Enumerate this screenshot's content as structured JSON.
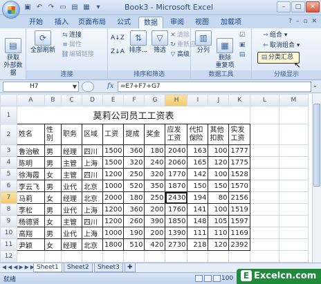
{
  "window": {
    "title": "Book3 - Microsoft Excel"
  },
  "tabs": [
    "开始",
    "插入",
    "页面布局",
    "公式",
    "数据",
    "审阅",
    "视图",
    "加载项"
  ],
  "active_tab": "数据",
  "ribbon": {
    "get_external": "获取\n外部数据",
    "refresh_all": "全部刷新",
    "connections": "连接",
    "properties": "属性",
    "edit_links": "编辑链接",
    "sort_az": "A↓Z",
    "sort_za": "Z↓A",
    "sort": "排序...",
    "filter": "筛选",
    "clear": "清除",
    "reapply": "重新应用",
    "advanced": "高级",
    "text_to_columns": "分列",
    "remove_duplicates": "删除\n重复项",
    "group": "组合",
    "ungroup": "取消组合",
    "subtotal": "分类汇总",
    "groups": {
      "connections": "连接",
      "sort_filter": "排序和筛选",
      "data_tools": "数据工具",
      "outline": "分级显示"
    }
  },
  "formula_bar": {
    "name_box": "H7",
    "fx": "fx",
    "formula": "=E7+F7+G7"
  },
  "columns": [
    "A",
    "B",
    "C",
    "D",
    "E",
    "F",
    "G",
    "H",
    "I",
    "J",
    "K",
    "L",
    "M"
  ],
  "rows": [
    "1",
    "2",
    "3",
    "4",
    "5",
    "6",
    "7",
    "8",
    "9",
    "10",
    "11",
    "12"
  ],
  "sheet": {
    "title": "莫莉公司员工工资表",
    "headers": [
      "姓名",
      "性别",
      "职务",
      "区域",
      "工资",
      "提成",
      "奖金",
      "应发\n工资",
      "代扣\n保险",
      "其他\n扣款",
      "实发\n工资"
    ],
    "data": [
      [
        "鲁治敏",
        "男",
        "经理",
        "四川",
        "1500",
        "360",
        "180",
        "2040",
        "163",
        "100",
        "1777"
      ],
      [
        "陈明",
        "男",
        "主管",
        "上海",
        "1500",
        "320",
        "240",
        "2060",
        "165",
        "120",
        "1775"
      ],
      [
        "徐海霞",
        "女",
        "主管",
        "四川",
        "1200",
        "250",
        "320",
        "1770",
        "142",
        "100",
        "1528"
      ],
      [
        "李云飞",
        "男",
        "业代",
        "北京",
        "1000",
        "520",
        "350",
        "1870",
        "150",
        "150",
        "1570"
      ],
      [
        "马莉",
        "女",
        "经理",
        "北京",
        "2000",
        "180",
        "250",
        "2430",
        "194",
        "80",
        "2156"
      ],
      [
        "李松",
        "男",
        "业代",
        "上海",
        "1200",
        "360",
        "200",
        "1760",
        "141",
        "100",
        "1519"
      ],
      [
        "杨德贤",
        "女",
        "主管",
        "四川",
        "1200",
        "260",
        "390",
        "1850",
        "148",
        "105",
        "1597"
      ],
      [
        "高翔",
        "男",
        "业代",
        "上海",
        "1000",
        "190",
        "200",
        "1390",
        "111",
        "110",
        "1169"
      ],
      [
        "尹颖",
        "女",
        "经理",
        "北京",
        "1800",
        "510",
        "420",
        "2730",
        "218",
        "120",
        "2392"
      ]
    ]
  },
  "sheet_tabs": [
    "Sheet1",
    "Sheet2",
    "Sheet3"
  ],
  "status": {
    "mode": "就绪",
    "zoom": "100"
  },
  "watermark": "Excelcn.com"
}
